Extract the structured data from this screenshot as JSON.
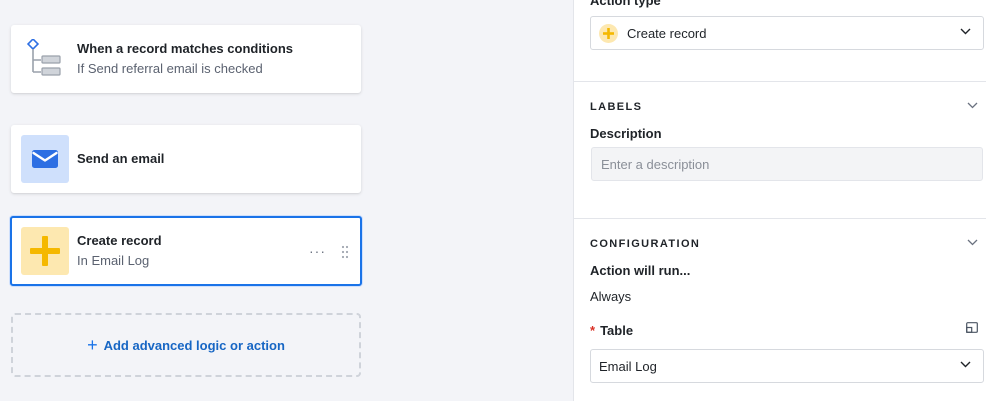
{
  "workflow": {
    "trigger": {
      "title": "When a record matches conditions",
      "subtitle": "If Send referral email is checked"
    },
    "email_step": {
      "title": "Send an email"
    },
    "create_step": {
      "title": "Create record",
      "subtitle": "In Email Log",
      "more_glyph": "···"
    },
    "add_logic": {
      "plus": "+",
      "label": "Add advanced logic or action"
    }
  },
  "panel": {
    "action_type": {
      "label": "Action type",
      "value": "Create record"
    },
    "labels_section": {
      "title": "LABELS",
      "description_label": "Description",
      "description_value": "",
      "description_placeholder": "Enter a description"
    },
    "configuration_section": {
      "title": "CONFIGURATION",
      "run_label": "Action will run...",
      "run_value": "Always",
      "table_required_mark": "*",
      "table_label": "Table",
      "table_value": "Email Log"
    }
  },
  "colors": {
    "accent": "#1a73e8",
    "email_icon": "#2d6fe3",
    "create_icon": "#f5b800",
    "required": "#d93025"
  },
  "icons": {
    "trigger": "condition-tree-icon",
    "email": "envelope-icon",
    "create": "plus-icon",
    "drag": "drag-handle-icon",
    "chevron": "chevron-down-icon",
    "table": "expand-icon"
  }
}
